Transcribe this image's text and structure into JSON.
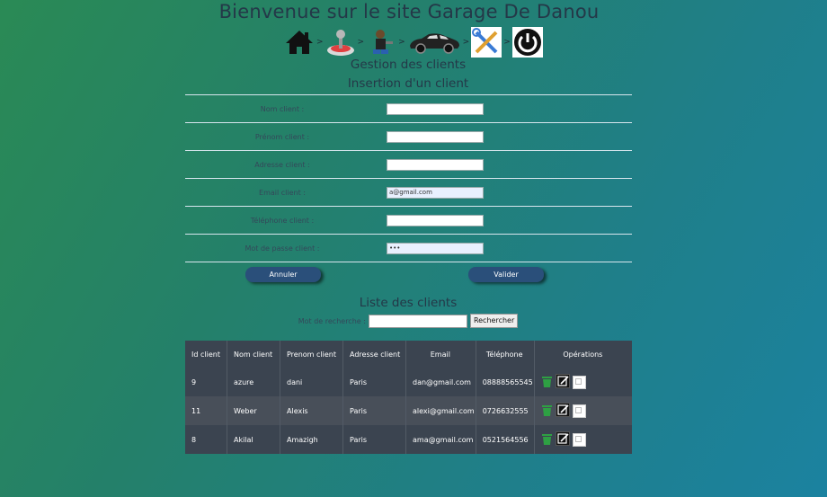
{
  "header": {
    "title": "Bienvenue sur le site Garage De Danou",
    "nav": [
      {
        "icon": "home-icon",
        "sep": ">"
      },
      {
        "icon": "joystick-icon",
        "sep": ">"
      },
      {
        "icon": "mechanic-icon",
        "sep": ">"
      },
      {
        "icon": "car-icon",
        "sep": ">"
      },
      {
        "icon": "tools-icon",
        "sep": ">"
      },
      {
        "icon": "power-icon",
        "sep": ""
      }
    ]
  },
  "section": {
    "title": "Gestion des clients",
    "insert_title": "Insertion d'un client"
  },
  "form": {
    "fields": [
      {
        "label": "Nom client :",
        "value": ""
      },
      {
        "label": "Prénom client :",
        "value": ""
      },
      {
        "label": "Adresse client :",
        "value": ""
      },
      {
        "label": "Email client :",
        "value": "a@gmail.com"
      },
      {
        "label": "Téléphone client :",
        "value": ""
      },
      {
        "label": "Mot de passe client :",
        "value": "•••"
      }
    ],
    "cancel_label": "Annuler",
    "submit_label": "Valider"
  },
  "list": {
    "title": "Liste des clients",
    "search_label": "Mot de recherche :",
    "search_value": "",
    "search_button": "Rechercher",
    "columns": [
      "Id client",
      "Nom client",
      "Prenom client",
      "Adresse client",
      "Email",
      "Téléphone",
      "Opérations"
    ],
    "rows": [
      {
        "id": "9",
        "nom": "azure",
        "prenom": "dani",
        "adresse": "Paris",
        "email": "dan@gmail.com",
        "tel": "08888565545"
      },
      {
        "id": "11",
        "nom": "Weber",
        "prenom": "Alexis",
        "adresse": "Paris",
        "email": "alexi@gmail.com",
        "tel": "0726632555"
      },
      {
        "id": "8",
        "nom": "Akilal",
        "prenom": "Amazigh",
        "adresse": "Paris",
        "email": "ama@gmail.com",
        "tel": "0521564556"
      }
    ]
  },
  "colors": {
    "button_bg": "#2a4f7a",
    "table_header": "#3b4450",
    "delete_icon": "#2ea043"
  }
}
